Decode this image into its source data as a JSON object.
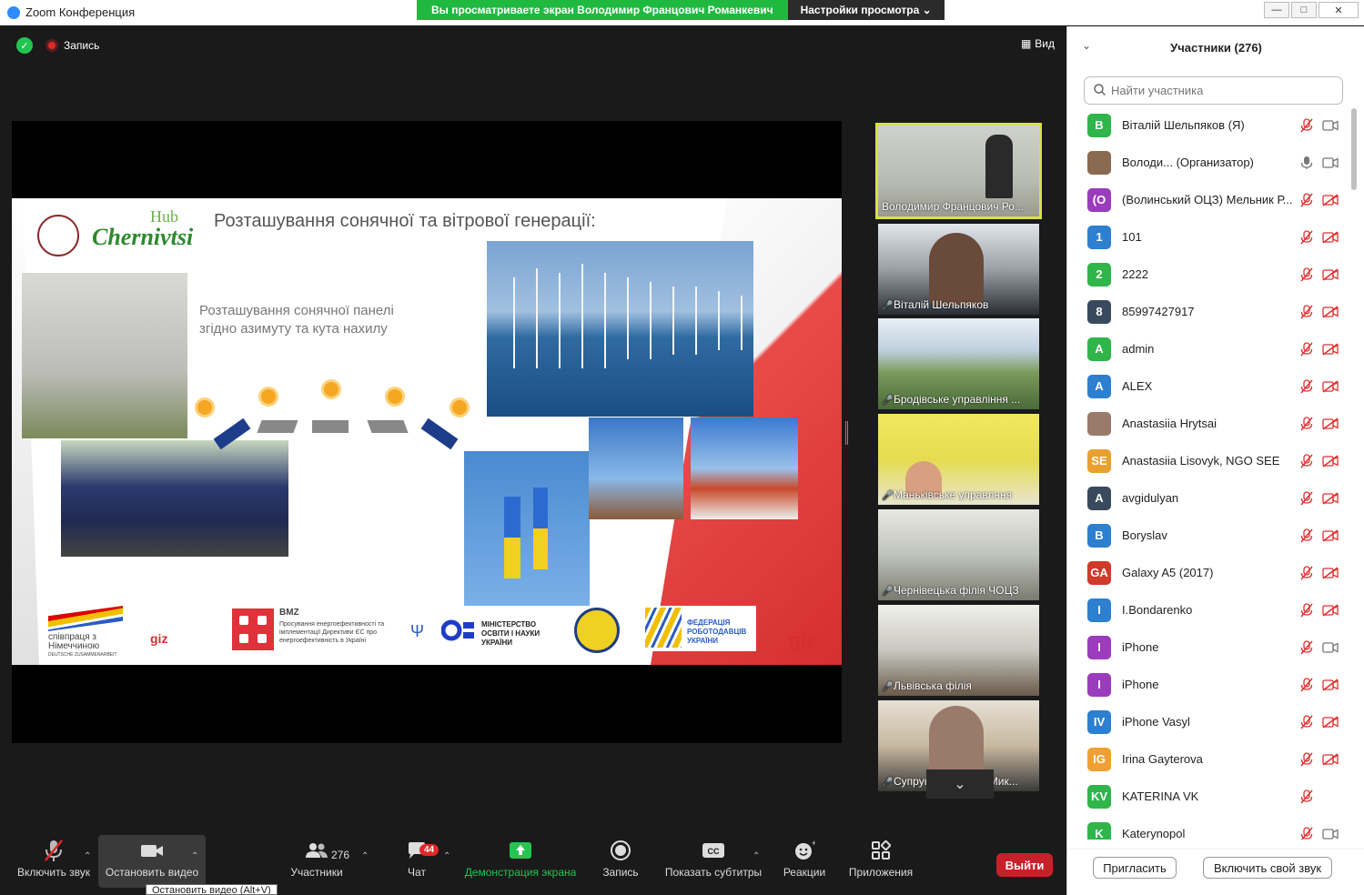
{
  "window": {
    "app_title": "Zoom Конференция",
    "share_banner": "Вы просматриваете экран Володимир Францович Романкевич",
    "view_settings": "Настройки просмотра"
  },
  "meeting": {
    "recording_label": "Запись",
    "view_label": "Вид"
  },
  "slide": {
    "title": "Розташування сонячної та вітрової генерації:",
    "subtitle": "Розташування сонячної панелі згідно азимуту та кута нахилу",
    "logo_hub": "Hub",
    "logo_city": "Chernivtsi",
    "footer": {
      "cooperation": "співпраця з Німеччиною",
      "deutsche": "DEUTSCHE ZUSAMMENARBEIT",
      "giz_small": "giz",
      "bmz": "BMZ",
      "bmz_text": "Просування енергоефективності та імплементації Директиви ЄС про енергоефективність в Україні",
      "ministry": "МІНІСТЕРСТВО ОСВІТИ І НАУКИ УКРАЇНИ",
      "federation": "ФЕДЕРАЦІЯ РОБОТОДАВЦІВ УКРАЇНИ",
      "giz_big": "giz"
    }
  },
  "thumbnails": [
    {
      "name": "Володимир Францович Ро...",
      "active": true,
      "muted": false
    },
    {
      "name": "Віталій Шельпяков",
      "active": false,
      "muted": true
    },
    {
      "name": "Бродівське управління ...",
      "active": false,
      "muted": true
    },
    {
      "name": "Маньківське управлння",
      "active": false,
      "muted": true
    },
    {
      "name": "Чернівецька філія ЧОЦЗ",
      "active": false,
      "muted": true
    },
    {
      "name": "Львівська філія",
      "active": false,
      "muted": true
    },
    {
      "name": "Супруненко Ганна Мик...",
      "active": false,
      "muted": true
    }
  ],
  "toolbar": {
    "unmute": "Включить звук",
    "stop_video": "Остановить видео",
    "participants": "Участники",
    "participants_count": "276",
    "chat": "Чат",
    "chat_badge": "44",
    "share_screen": "Демонстрация экрана",
    "record": "Запись",
    "captions": "Показать субтитры",
    "reactions": "Реакции",
    "apps": "Приложения",
    "leave": "Выйти",
    "tooltip": "Остановить видео (Alt+V)"
  },
  "participants_panel": {
    "title": "Участники (276)",
    "search_placeholder": "Найти участника",
    "invite": "Пригласить",
    "unmute_me": "Включить свой звук",
    "list": [
      {
        "initial": "В",
        "name": "Віталій Шельпяков (Я)",
        "color": "#2fb54a",
        "cam_on": true,
        "mic_on": false
      },
      {
        "initial": "",
        "name": "Володи... (Организатор)",
        "color": "#8a6a50",
        "cam_on": true,
        "mic_on": true
      },
      {
        "initial": "(О",
        "name": "(Волинський ОЦЗ) Мельник Р...",
        "color": "#9a3cbc",
        "cam_on": false,
        "mic_on": false
      },
      {
        "initial": "1",
        "name": "101",
        "color": "#2d7fd0",
        "cam_on": false,
        "mic_on": false
      },
      {
        "initial": "2",
        "name": "2222",
        "color": "#2fb54a",
        "cam_on": false,
        "mic_on": false
      },
      {
        "initial": "8",
        "name": "85997427917",
        "color": "#3a4a5e",
        "cam_on": false,
        "mic_on": false
      },
      {
        "initial": "A",
        "name": "admin",
        "color": "#2fb54a",
        "cam_on": false,
        "mic_on": false
      },
      {
        "initial": "A",
        "name": "ALEX",
        "color": "#2d7fd0",
        "cam_on": false,
        "mic_on": false
      },
      {
        "initial": "",
        "name": "Anastasiia Hrytsai",
        "color": "#9a7a6a",
        "cam_on": false,
        "mic_on": false
      },
      {
        "initial": "SE",
        "name": "Anastasiia Lisovyk, NGO SEE",
        "color": "#e8a030",
        "cam_on": false,
        "mic_on": false
      },
      {
        "initial": "A",
        "name": "avgidulyan",
        "color": "#3a4a5e",
        "cam_on": false,
        "mic_on": false
      },
      {
        "initial": "B",
        "name": "Boryslav",
        "color": "#2d7fd0",
        "cam_on": false,
        "mic_on": false
      },
      {
        "initial": "GA",
        "name": "Galaxy A5 (2017)",
        "color": "#d03a2a",
        "cam_on": false,
        "mic_on": false
      },
      {
        "initial": "I",
        "name": "I.Bondarenko",
        "color": "#2d7fd0",
        "cam_on": false,
        "mic_on": false
      },
      {
        "initial": "I",
        "name": "iPhone",
        "color": "#9a3cbc",
        "cam_on": true,
        "mic_on": false
      },
      {
        "initial": "I",
        "name": "iPhone",
        "color": "#9a3cbc",
        "cam_on": false,
        "mic_on": false
      },
      {
        "initial": "IV",
        "name": "iPhone Vasyl",
        "color": "#2d7fd0",
        "cam_on": false,
        "mic_on": false
      },
      {
        "initial": "IG",
        "name": "Irina Gayterova",
        "color": "#f0a030",
        "cam_on": false,
        "mic_on": false
      },
      {
        "initial": "KV",
        "name": "KATERINA VK",
        "color": "#2fb54a",
        "cam_on": null,
        "mic_on": false
      },
      {
        "initial": "K",
        "name": "Katerynopol",
        "color": "#2fb54a",
        "cam_on": true,
        "mic_on": false
      }
    ]
  }
}
